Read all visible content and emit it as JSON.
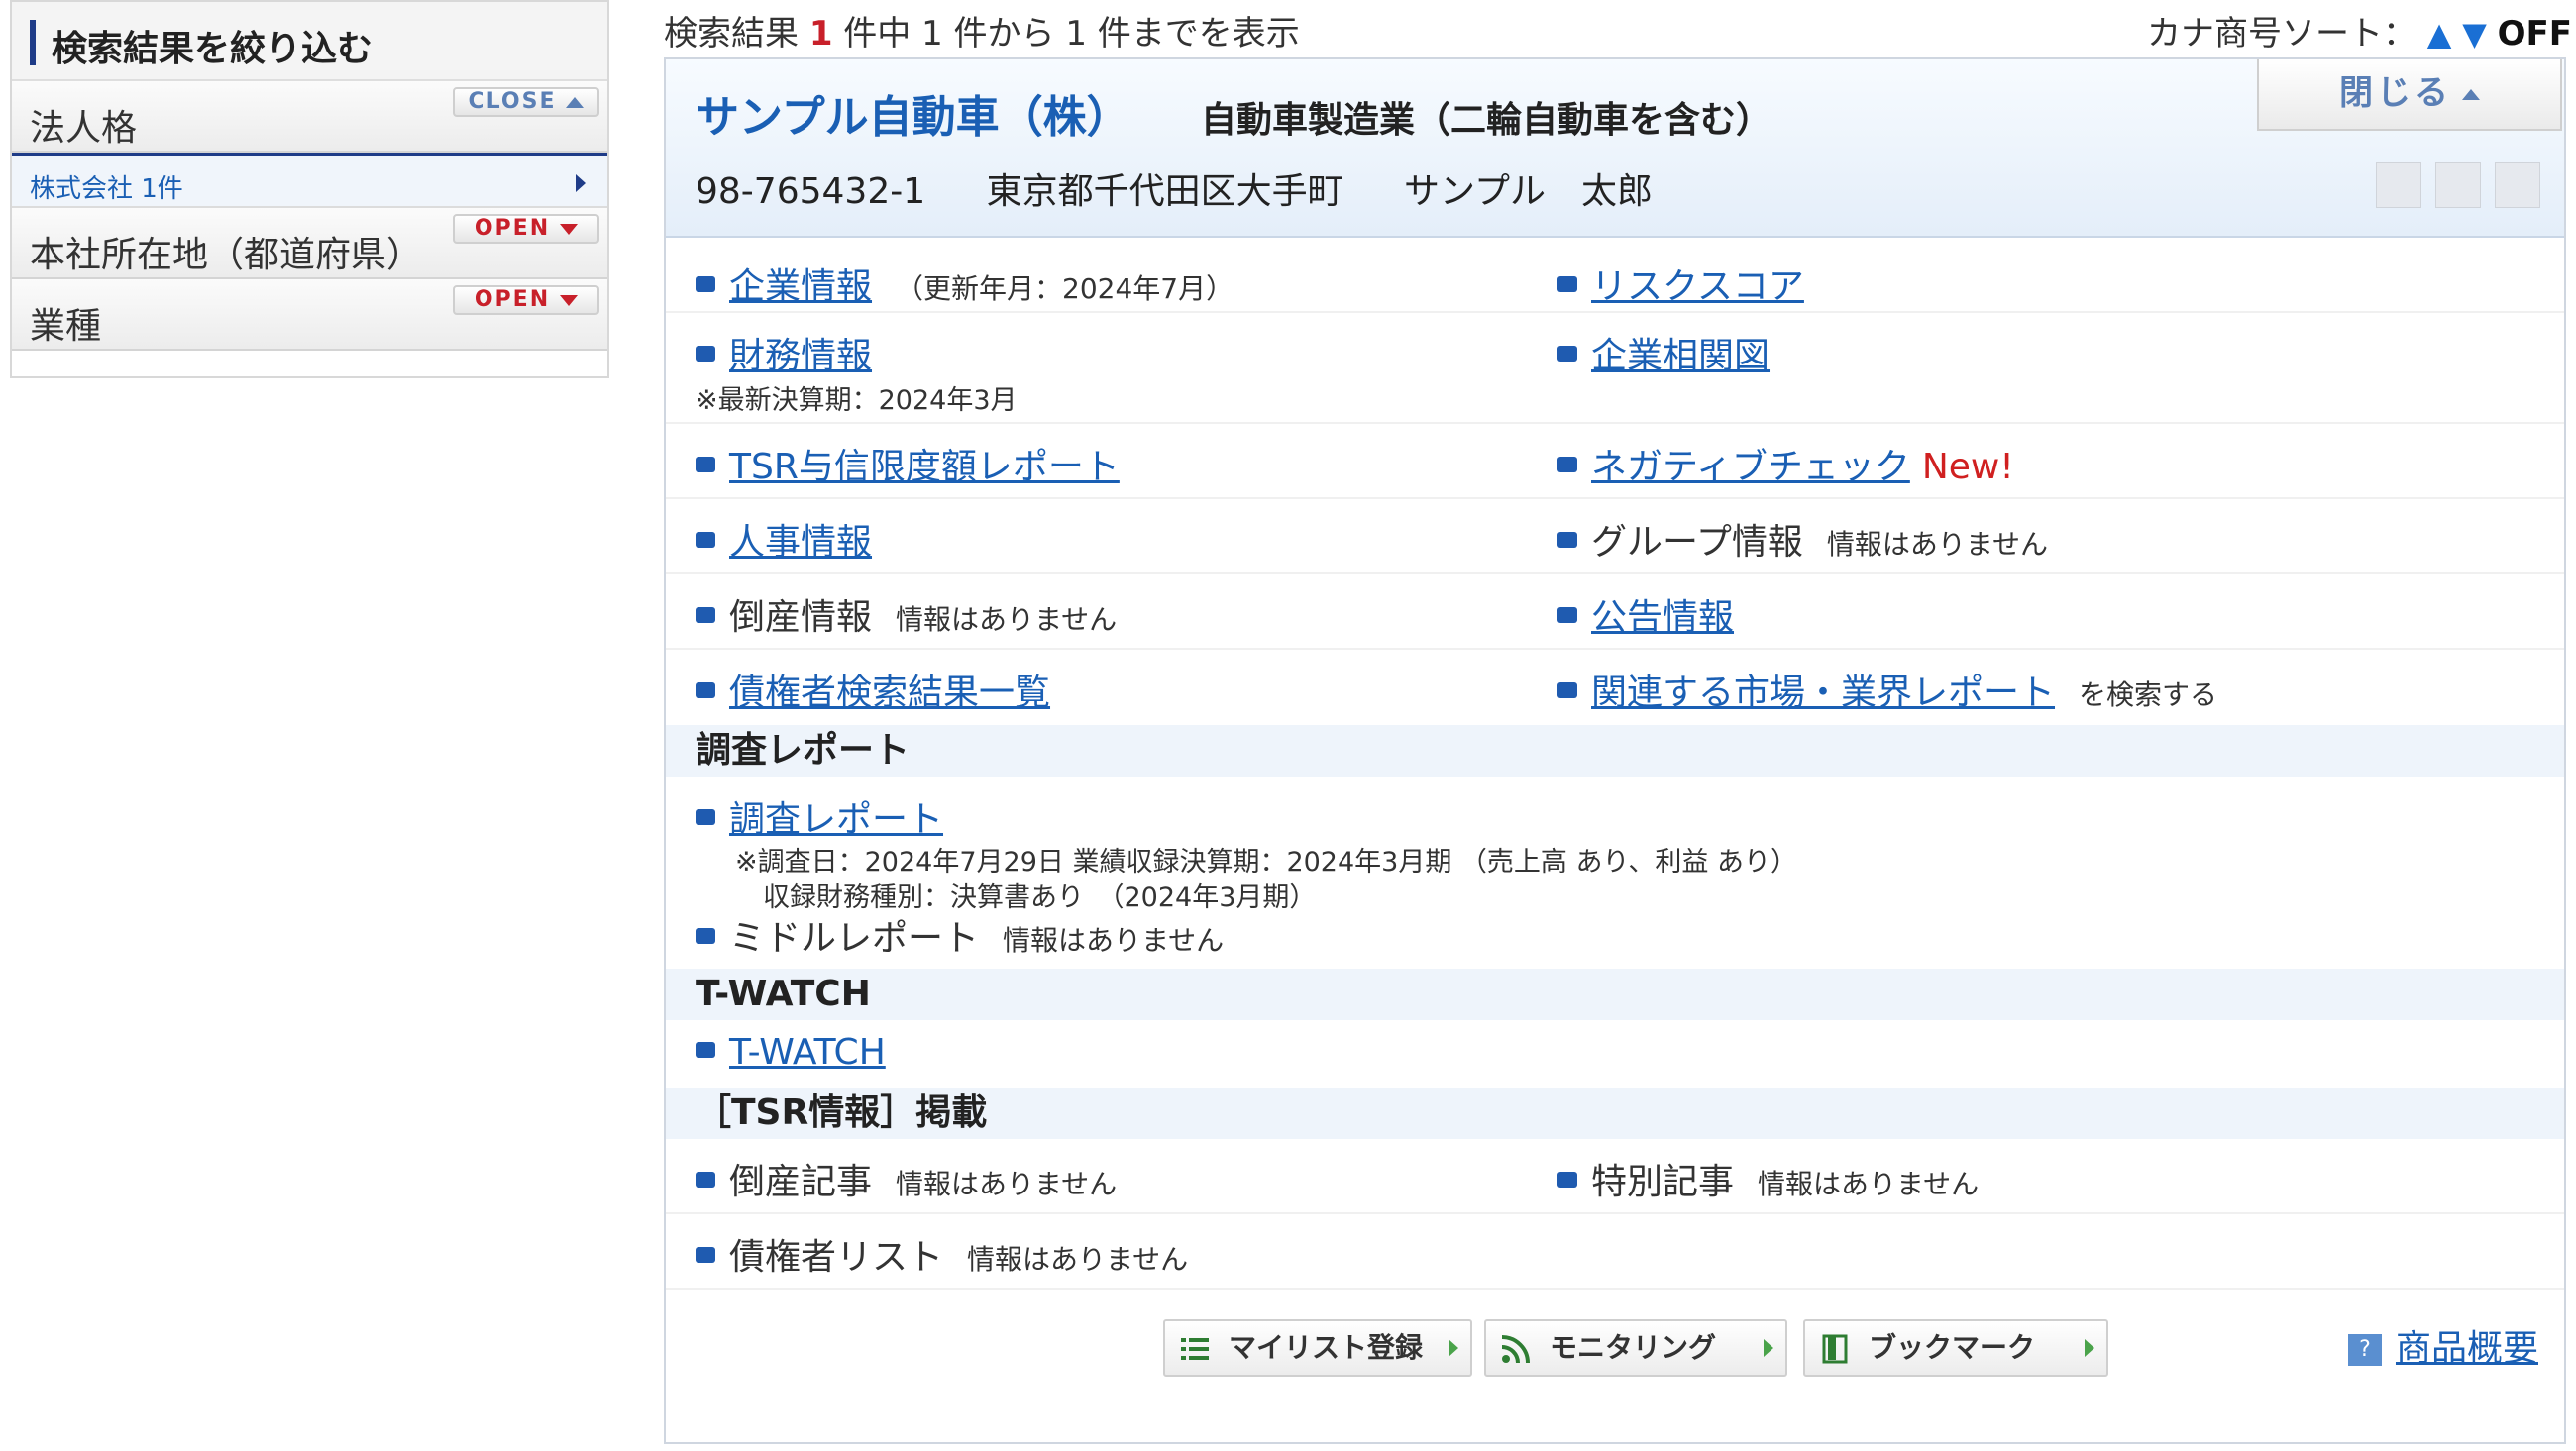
{
  "sidebar": {
    "title": "検索結果を絞り込む",
    "close_label": "CLOSE",
    "open_label": "OPEN",
    "groups": [
      {
        "label": "法人格"
      },
      {
        "label": "本社所在地（都道府県）"
      },
      {
        "label": "業種"
      }
    ],
    "active_item": "株式会社 1件"
  },
  "topbar": {
    "prefix": "検索結果",
    "count": "1",
    "suffix": "件中 1 件から 1 件までを表示"
  },
  "sort": {
    "label": "カナ商号ソート：",
    "up": "▲",
    "down": "▼",
    "state": "OFF"
  },
  "company": {
    "name": "サンプル自動車（株）",
    "industry": "自動車製造業（二輪自動車を含む）",
    "code": "98-765432-1",
    "address": "東京都千代田区大手町",
    "representative": "サンプル　太郎",
    "close_label": "閉じる"
  },
  "items": {
    "corp_info": "企業情報",
    "corp_info_note": "（更新年月：2024年7月）",
    "risk_score": "リスクスコア",
    "financial": "財務情報",
    "financial_note": "※最新決算期：2024年3月",
    "corp_map": "企業相関図",
    "credit_report": "TSR与信限度額レポート",
    "negative_check": "ネガティブチェック",
    "new_badge": "New!",
    "hr_info": "人事情報",
    "group_info": "グループ情報",
    "bankruptcy_info": "倒産情報",
    "notice_info": "公告情報",
    "creditor_search": "債権者検索結果一覧",
    "market_report": "関連する市場・業界レポート",
    "market_report_note": "を検索する",
    "no_info": "情報はありません"
  },
  "sections": {
    "survey": "調査レポート",
    "twatch": "T-WATCH",
    "tsr": "［TSR情報］掲載"
  },
  "survey": {
    "report_link": "調査レポート",
    "note1": "※調査日：2024年7月29日 業績収録決算期：2024年3月期 （売上高 あり、利益 あり）",
    "note2": "収録財務種別：決算書あり　（2024年3月期）",
    "middle_report": "ミドルレポート"
  },
  "twatch": {
    "link": "T-WATCH"
  },
  "tsr": {
    "bankruptcy_article": "倒産記事",
    "special_article": "特別記事",
    "creditor_list": "債権者リスト"
  },
  "footer": {
    "mylist": "マイリスト登録",
    "monitoring": "モニタリング",
    "bookmark": "ブックマーク",
    "product": "商品概要",
    "help_icon_glyph": "?"
  }
}
